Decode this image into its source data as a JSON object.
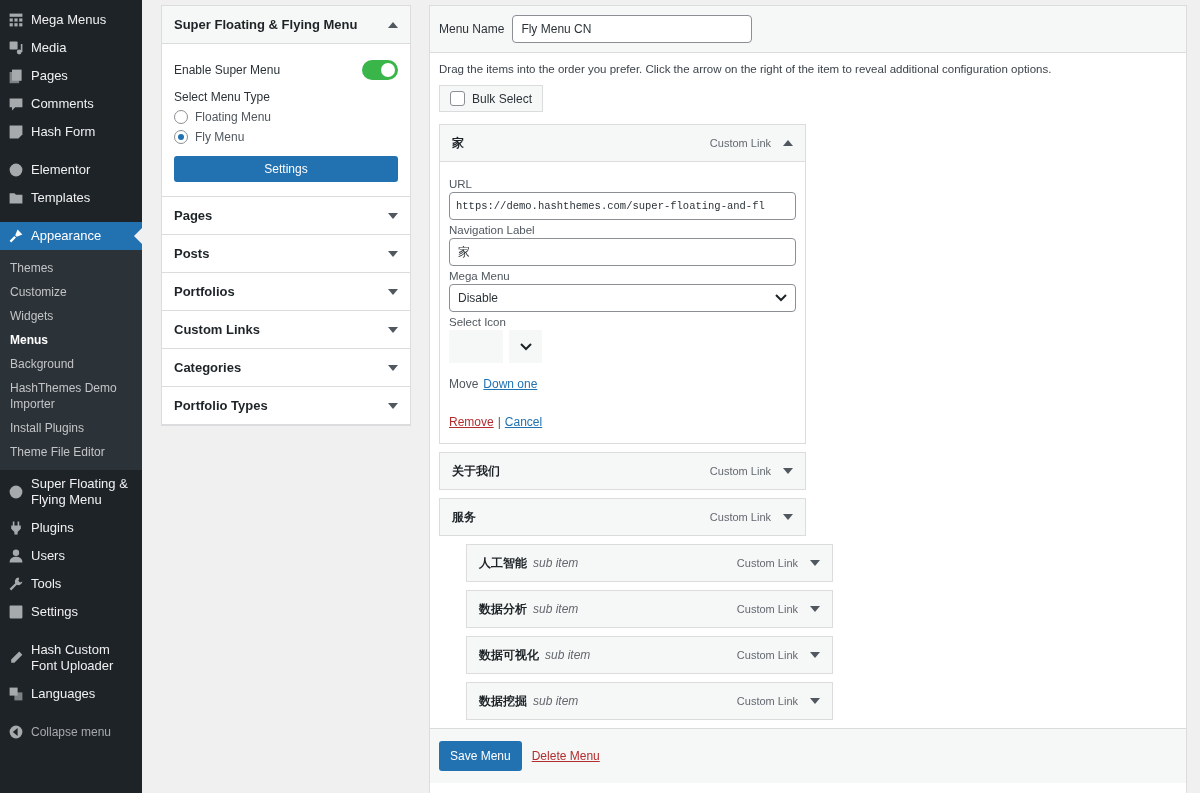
{
  "sidebar": {
    "groups": [
      [
        {
          "label": "Mega Menus",
          "selected": false
        },
        {
          "label": "Media",
          "selected": false
        },
        {
          "label": "Pages",
          "selected": false
        },
        {
          "label": "Comments",
          "selected": false
        },
        {
          "label": "Hash Form",
          "selected": false
        }
      ],
      [
        {
          "label": "Elementor",
          "selected": false
        },
        {
          "label": "Templates",
          "selected": false
        }
      ],
      [
        {
          "label": "Appearance",
          "selected": true,
          "children": [
            {
              "label": "Themes",
              "selected": false
            },
            {
              "label": "Customize",
              "selected": false
            },
            {
              "label": "Widgets",
              "selected": false
            },
            {
              "label": "Menus",
              "selected": true
            },
            {
              "label": "Background",
              "selected": false
            },
            {
              "label": "HashThemes Demo Importer",
              "selected": false
            },
            {
              "label": "Install Plugins",
              "selected": false
            },
            {
              "label": "Theme File Editor",
              "selected": false
            }
          ]
        },
        {
          "label": "Super Floating & Flying Menu",
          "selected": false
        },
        {
          "label": "Plugins",
          "selected": false
        },
        {
          "label": "Users",
          "selected": false
        },
        {
          "label": "Tools",
          "selected": false
        },
        {
          "label": "Settings",
          "selected": false
        }
      ],
      [
        {
          "label": "Hash Custom Font Uploader",
          "selected": false
        },
        {
          "label": "Languages",
          "selected": false
        }
      ]
    ],
    "collapse": "Collapse menu"
  },
  "super_menu": {
    "title": "Super Floating & Flying Menu",
    "expanded": true,
    "toggle_label": "Enable Super Menu",
    "toggle_on": true,
    "type_label": "Select Menu Type",
    "types": [
      {
        "label": "Floating Menu",
        "selected": false
      },
      {
        "label": "Fly Menu",
        "selected": true
      }
    ],
    "button": "Settings"
  },
  "sections": [
    {
      "title": "Pages",
      "expanded": false
    },
    {
      "title": "Posts",
      "expanded": false
    },
    {
      "title": "Portfolios",
      "expanded": false
    },
    {
      "title": "Custom Links",
      "expanded": false
    },
    {
      "title": "Categories",
      "expanded": false
    },
    {
      "title": "Portfolio Types",
      "expanded": false
    }
  ],
  "menu": {
    "name_label": "Menu Name",
    "name": "Fly Menu CN",
    "instructions": "Drag the items into the order you prefer. Click the arrow on the right of the item to reveal additional configuration options.",
    "bulk_select": {
      "label": "Bulk Select",
      "checked": false
    },
    "items": [
      {
        "title": "家",
        "type": "Custom Link",
        "expanded": true,
        "fields": {
          "url_label": "URL",
          "url": "https://demo.hashthemes.com/super-floating-and-fl",
          "nav_label": "Navigation Label",
          "nav": "家",
          "mega_label": "Mega Menu",
          "mega": "Disable",
          "icon_label": "Select Icon",
          "move_label": "Move",
          "move_link": "Down one",
          "remove": "Remove",
          "separator": "|",
          "cancel": "Cancel"
        }
      },
      {
        "title": "关于我们",
        "type": "Custom Link",
        "expanded": false
      },
      {
        "title": "服务",
        "type": "Custom Link",
        "expanded": false,
        "children": [
          {
            "title": "人工智能",
            "note": "sub item",
            "type": "Custom Link",
            "expanded": false
          },
          {
            "title": "数据分析",
            "note": "sub item",
            "type": "Custom Link",
            "expanded": false
          },
          {
            "title": "数据可视化",
            "note": "sub item",
            "type": "Custom Link",
            "expanded": false
          },
          {
            "title": "数据挖掘",
            "note": "sub item",
            "type": "Custom Link",
            "expanded": false
          }
        ]
      }
    ],
    "save": "Save Menu",
    "delete": "Delete Menu"
  }
}
